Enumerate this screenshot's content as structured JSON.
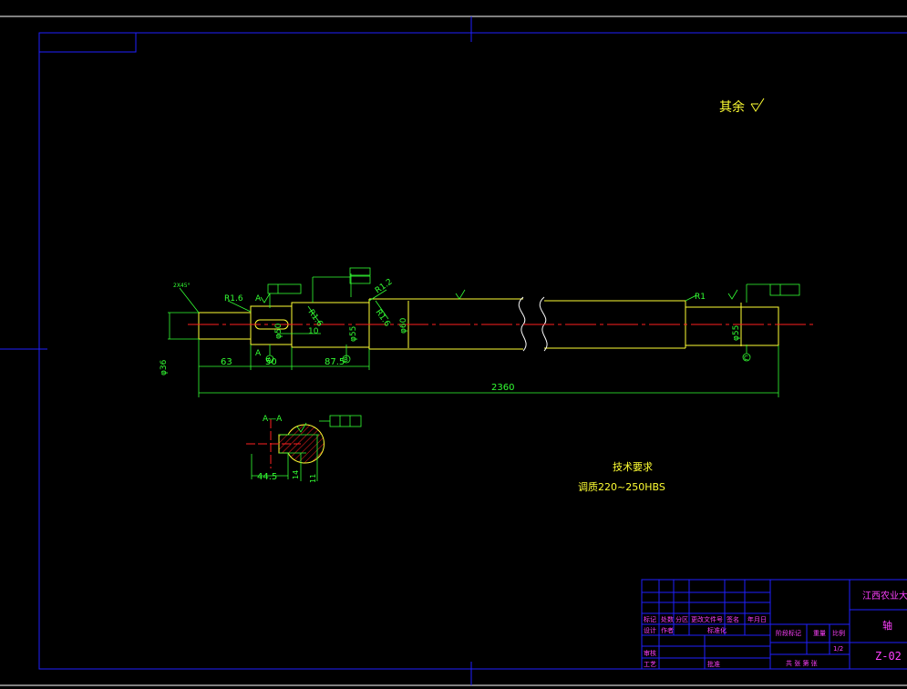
{
  "colors": {
    "background": "#000000",
    "frame": "#2020ff",
    "outline": "#ffff33",
    "dimension": "#33ff33",
    "centerline": "#ff2020",
    "section_fill": "#ff2020",
    "title_block_text": "#ff40ff",
    "white_line": "#ffffff"
  },
  "notes": {
    "surface_remaining": "其余",
    "tech_req_title": "技术要求",
    "tech_req_body": "调质220~250HBS"
  },
  "dimensions": {
    "total_length": "2360",
    "seg_63": "63",
    "seg_50": "50",
    "seg_10": "10",
    "seg_87_5": "87.5",
    "dia_36": "φ36",
    "dia_50": "φ50",
    "dia_55_left": "φ55",
    "dia_60": "φ60",
    "dia_55_right": "φ55",
    "chamfer": "2X45°",
    "section_depth": "44.5",
    "section_width": "14",
    "section_keyway": "11",
    "section_label_top": "A—A",
    "section_mark_a_top": "A",
    "section_mark_a_bottom": "A"
  },
  "radii": {
    "r1_6_left": "R1.6",
    "r1_6_mid": "R1.6",
    "r1_6_step": "R1.6",
    "r1_2": "R1.2",
    "r1": "R1"
  },
  "datum_labels": {
    "d1": "A",
    "d2": "B",
    "d3": "C"
  },
  "title_block": {
    "school": "江西农业大学",
    "part_name": "轴",
    "drawing_no": "Z-02",
    "scale": "1/2",
    "labels": {
      "mark": "标记",
      "count": "处数",
      "zone": "分区",
      "change_doc": "更改文件号",
      "sign": "签名",
      "date": "年月日",
      "design": "设计",
      "author": "作者",
      "standard": "标准化",
      "stage": "阶段标记",
      "weight": "重量",
      "ratio": "比例",
      "review": "审核",
      "process": "工艺",
      "approve": "批准",
      "sheets": "共 张 第 张"
    }
  }
}
